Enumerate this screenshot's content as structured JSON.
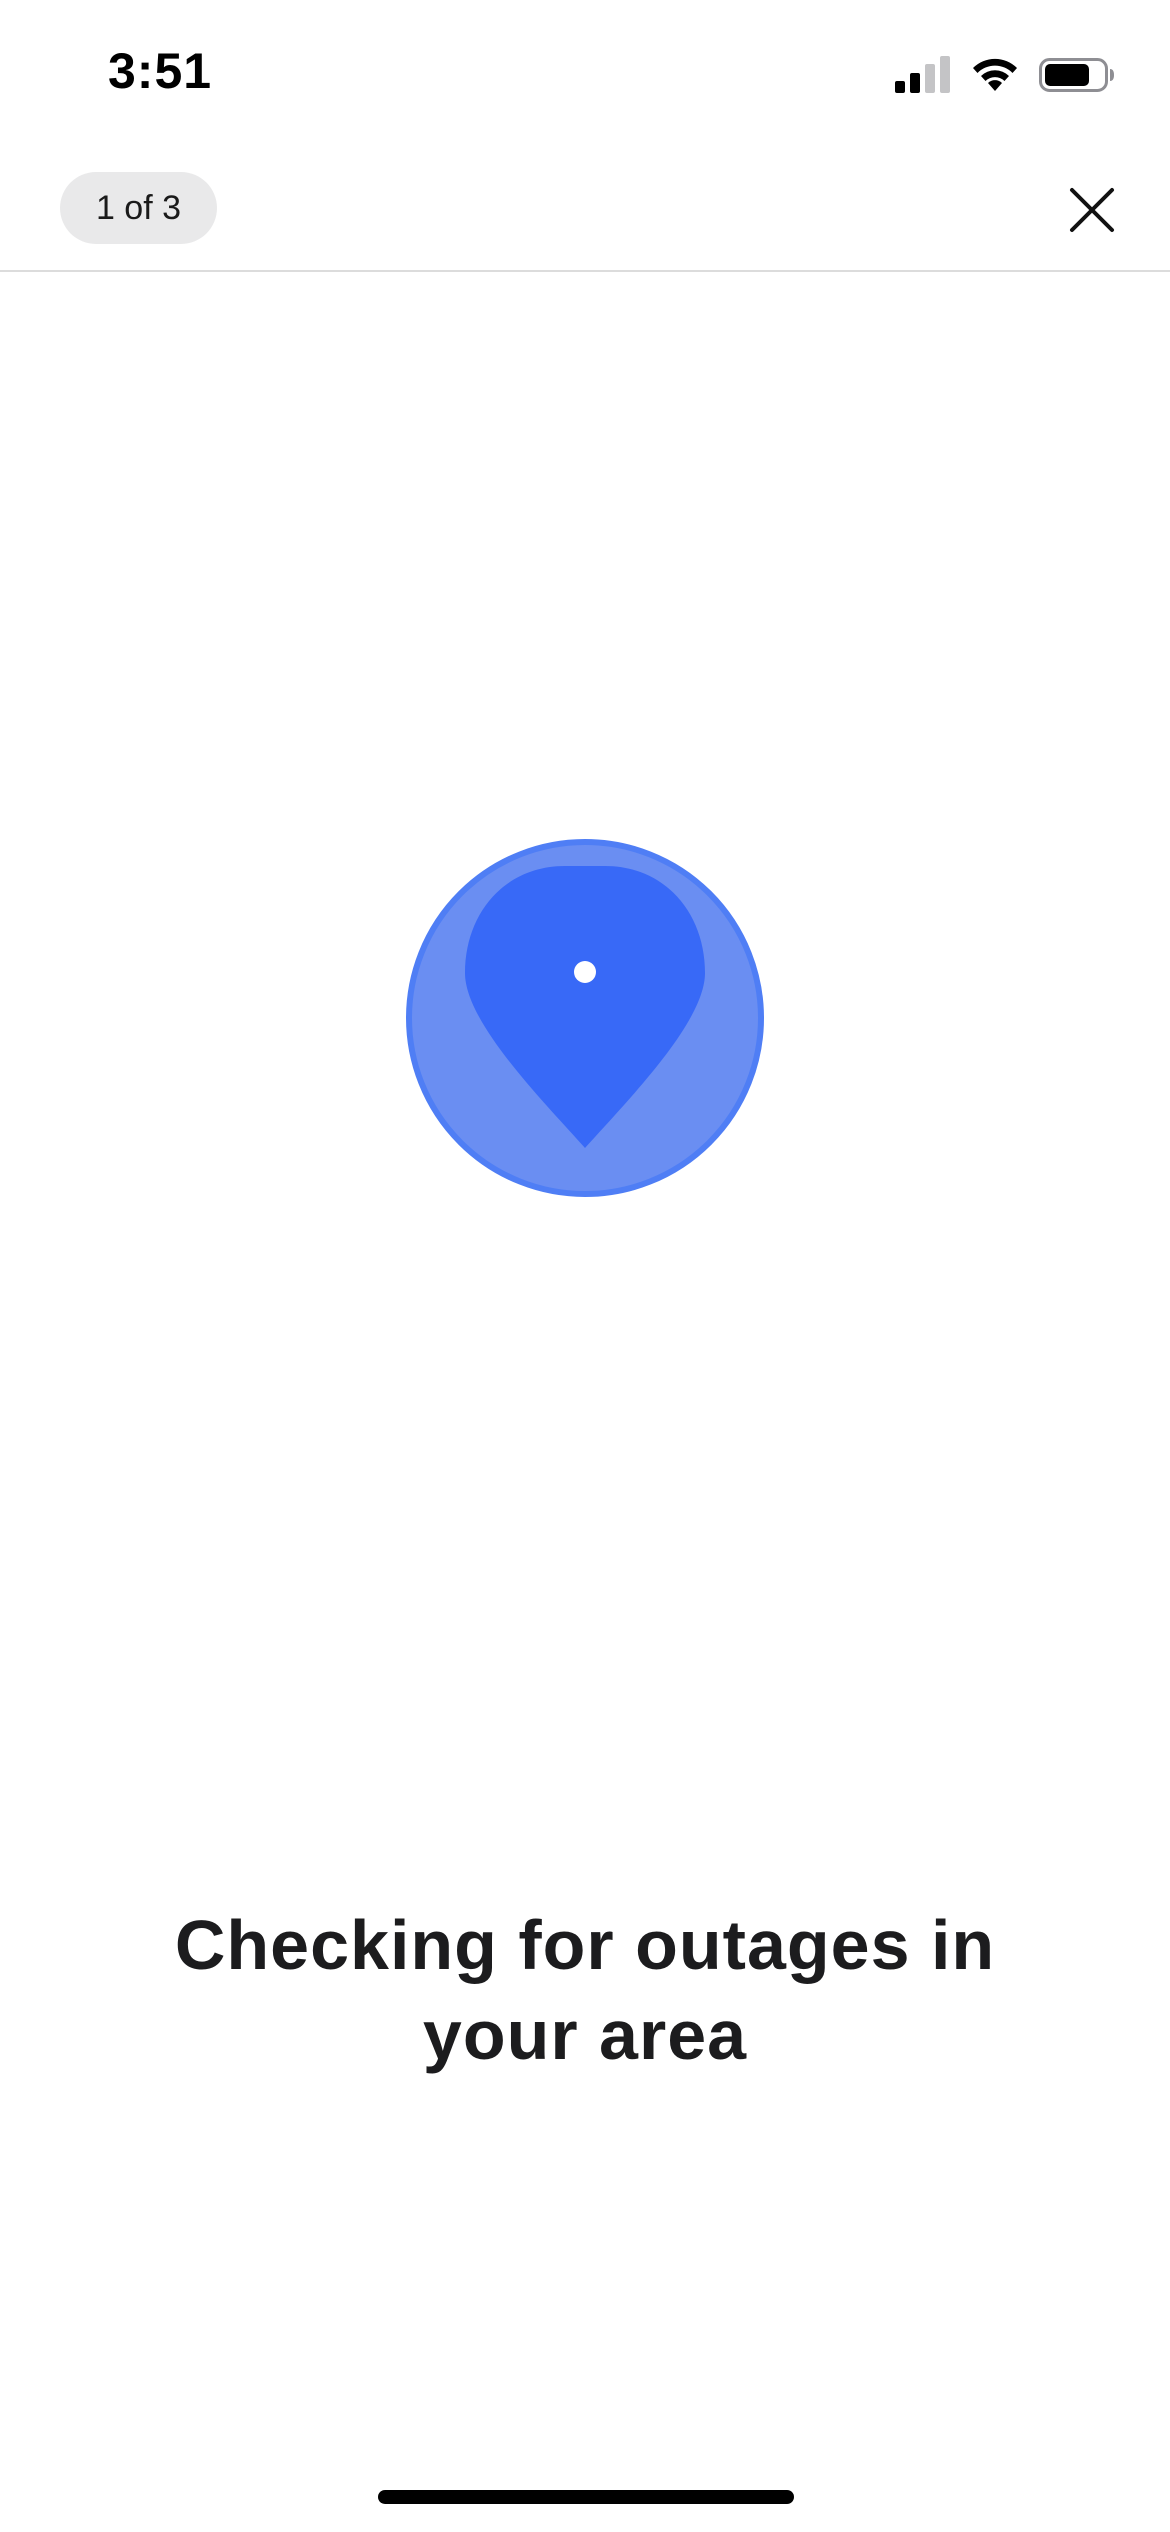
{
  "status_bar": {
    "time": "3:51",
    "icons": [
      "cellular-signal-icon",
      "wifi-icon",
      "battery-icon"
    ],
    "battery_level": 0.75
  },
  "nav": {
    "step_indicator": "1 of 3",
    "close_icon": "close-icon"
  },
  "illustration": {
    "icon": "location-pin-icon",
    "colors": {
      "outer_circle": "#6a8ef2",
      "outer_ring": "#4f7ef5",
      "pin": "#3869f7",
      "pin_dot": "#ffffff"
    }
  },
  "content": {
    "headline": "Checking for outages in your area"
  }
}
